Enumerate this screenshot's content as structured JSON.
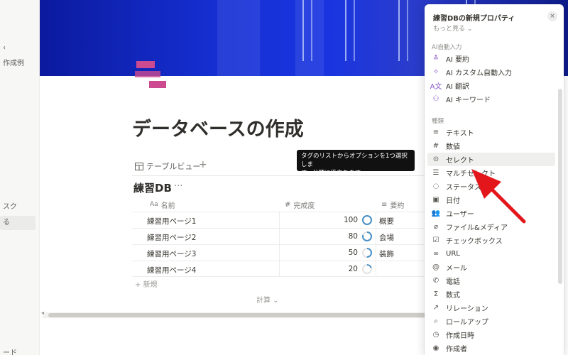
{
  "sidebar": {
    "items": [
      {
        "label": "作成例"
      },
      {
        "label": "スク"
      },
      {
        "label": "る"
      },
      {
        "label": "ード"
      }
    ]
  },
  "page": {
    "title": "データベースの作成",
    "view_label": "テーブルビュー",
    "add_view": "+",
    "db_title": "練習DB",
    "db_more": "···"
  },
  "table": {
    "columns": [
      {
        "label": "名前",
        "icon": "Aa"
      },
      {
        "label": "完成度",
        "icon": "#"
      },
      {
        "label": "要約",
        "icon": "≡"
      }
    ],
    "rows": [
      {
        "name": "練習用ページ1",
        "value": "100",
        "progress": 100,
        "summary": "概要"
      },
      {
        "name": "練習用ページ2",
        "value": "80",
        "progress": 80,
        "summary": "会場"
      },
      {
        "name": "練習用ページ3",
        "value": "50",
        "progress": 50,
        "summary": "装飾"
      },
      {
        "name": "練習用ページ4",
        "value": "20",
        "progress": 20,
        "summary": ""
      }
    ],
    "add_row": "新規",
    "calculate": "計算"
  },
  "tooltip": {
    "line1": "タグのリストからオプションを1つ選択しま",
    "line2": "す。分類に役立ちます。"
  },
  "panel": {
    "title": "練習DBの新規プロパティ",
    "more": "もっと見る",
    "close": "×",
    "ai_section": "AI自動入力",
    "ai_items": [
      {
        "label": "AI 要約",
        "icon": "ai-summary-icon",
        "glyph": "≛"
      },
      {
        "label": "AI カスタム自動入力",
        "icon": "ai-sparkle-icon",
        "glyph": "✧"
      },
      {
        "label": "AI 翻訳",
        "icon": "ai-translate-icon",
        "glyph": "A文"
      },
      {
        "label": "AI キーワード",
        "icon": "ai-keyword-icon",
        "glyph": "⚇"
      }
    ],
    "type_section": "種類",
    "types": [
      {
        "label": "テキスト",
        "icon": "text-icon",
        "glyph": "≡"
      },
      {
        "label": "数値",
        "icon": "number-icon",
        "glyph": "#"
      },
      {
        "label": "セレクト",
        "icon": "select-icon",
        "glyph": "⊙"
      },
      {
        "label": "マルチセレクト",
        "icon": "multi-select-icon",
        "glyph": "☰"
      },
      {
        "label": "ステータス",
        "icon": "status-icon",
        "glyph": "◌"
      },
      {
        "label": "日付",
        "icon": "calendar-icon",
        "glyph": "▣"
      },
      {
        "label": "ユーザー",
        "icon": "users-icon",
        "glyph": "👥"
      },
      {
        "label": "ファイル&メディア",
        "icon": "attachment-icon",
        "glyph": "⌀"
      },
      {
        "label": "チェックボックス",
        "icon": "checkbox-icon",
        "glyph": "☑"
      },
      {
        "label": "URL",
        "icon": "link-icon",
        "glyph": "∞"
      },
      {
        "label": "メール",
        "icon": "at-icon",
        "glyph": "@"
      },
      {
        "label": "電話",
        "icon": "phone-icon",
        "glyph": "✆"
      },
      {
        "label": "数式",
        "icon": "formula-icon",
        "glyph": "Σ"
      },
      {
        "label": "リレーション",
        "icon": "relation-icon",
        "glyph": "↗"
      },
      {
        "label": "ロールアップ",
        "icon": "rollup-icon",
        "glyph": "⌕"
      },
      {
        "label": "作成日時",
        "icon": "created-time-icon",
        "glyph": "◷"
      },
      {
        "label": "作成者",
        "icon": "created-by-icon",
        "glyph": "◉"
      }
    ],
    "highlighted": "セレクト"
  },
  "colors": {
    "cover_blue": "#1630d4",
    "icon_pink": "#cc4a90",
    "ring_blue": "#4a90c6",
    "annotation_red": "#e3171b"
  }
}
